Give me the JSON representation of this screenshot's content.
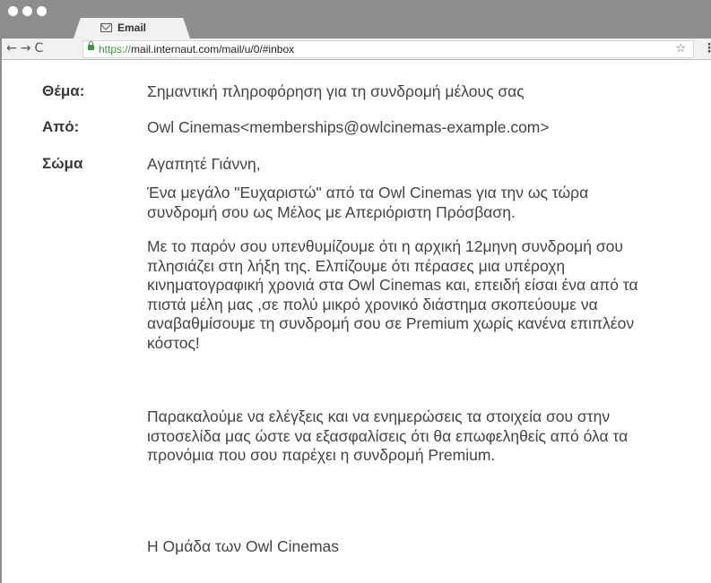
{
  "browser": {
    "tab_title": "Email",
    "url_scheme": "https://",
    "url_rest": "mail.internaut.com/mail/u/0/#inbox"
  },
  "email": {
    "subject_label": "Θέμα:",
    "subject": "Σημαντική πληροφόρηση για τη συνδρομή μέλους σας",
    "from_label": "Από:",
    "from": "Owl Cinemas<memberships@owlcinemas-example.com>",
    "body_label": "Σώμα",
    "greeting": "Αγαπητέ Γιάννη,",
    "paragraphs": [
      "Ένα μεγάλο \"Ευχαριστώ\" από τα Owl Cinemas για την ως τώρα συνδρομή σου ως Μέλος με Απεριόριστη Πρόσβαση.",
      "Με το παρόν σου υπενθυμίζουμε ότι η αρχική 12μηνη συνδρομή σου πλησιάζει στη λήξη της. Ελπίζουμε ότι πέρασες μια υπέροχη κινηματογραφική χρονιά στα Owl Cinemas και, επειδή είσαι ένα από τα πιστά μέλη μας ,σε πολύ μικρό χρονικό διάστημα σκοπεύουμε να αναβαθμίσουμε τη συνδρομή σου σε Premium χωρίς κανένα επιπλέον κόστος!",
      "Παρακαλούμε να ελέγξεις και να ενημερώσεις τα στοιχεία σου στην ιστοσελίδα μας ώστε να εξασφαλίσεις ότι θα επωφεληθείς από όλα τα προνόμια που σου παρέχει η συνδρομή Premium."
    ],
    "signature": "Η Ομάδα των Owl Cinemas"
  },
  "icons": {
    "back": "←",
    "forward": "→",
    "reload": "C",
    "star": "☆",
    "menu": "⋮"
  }
}
